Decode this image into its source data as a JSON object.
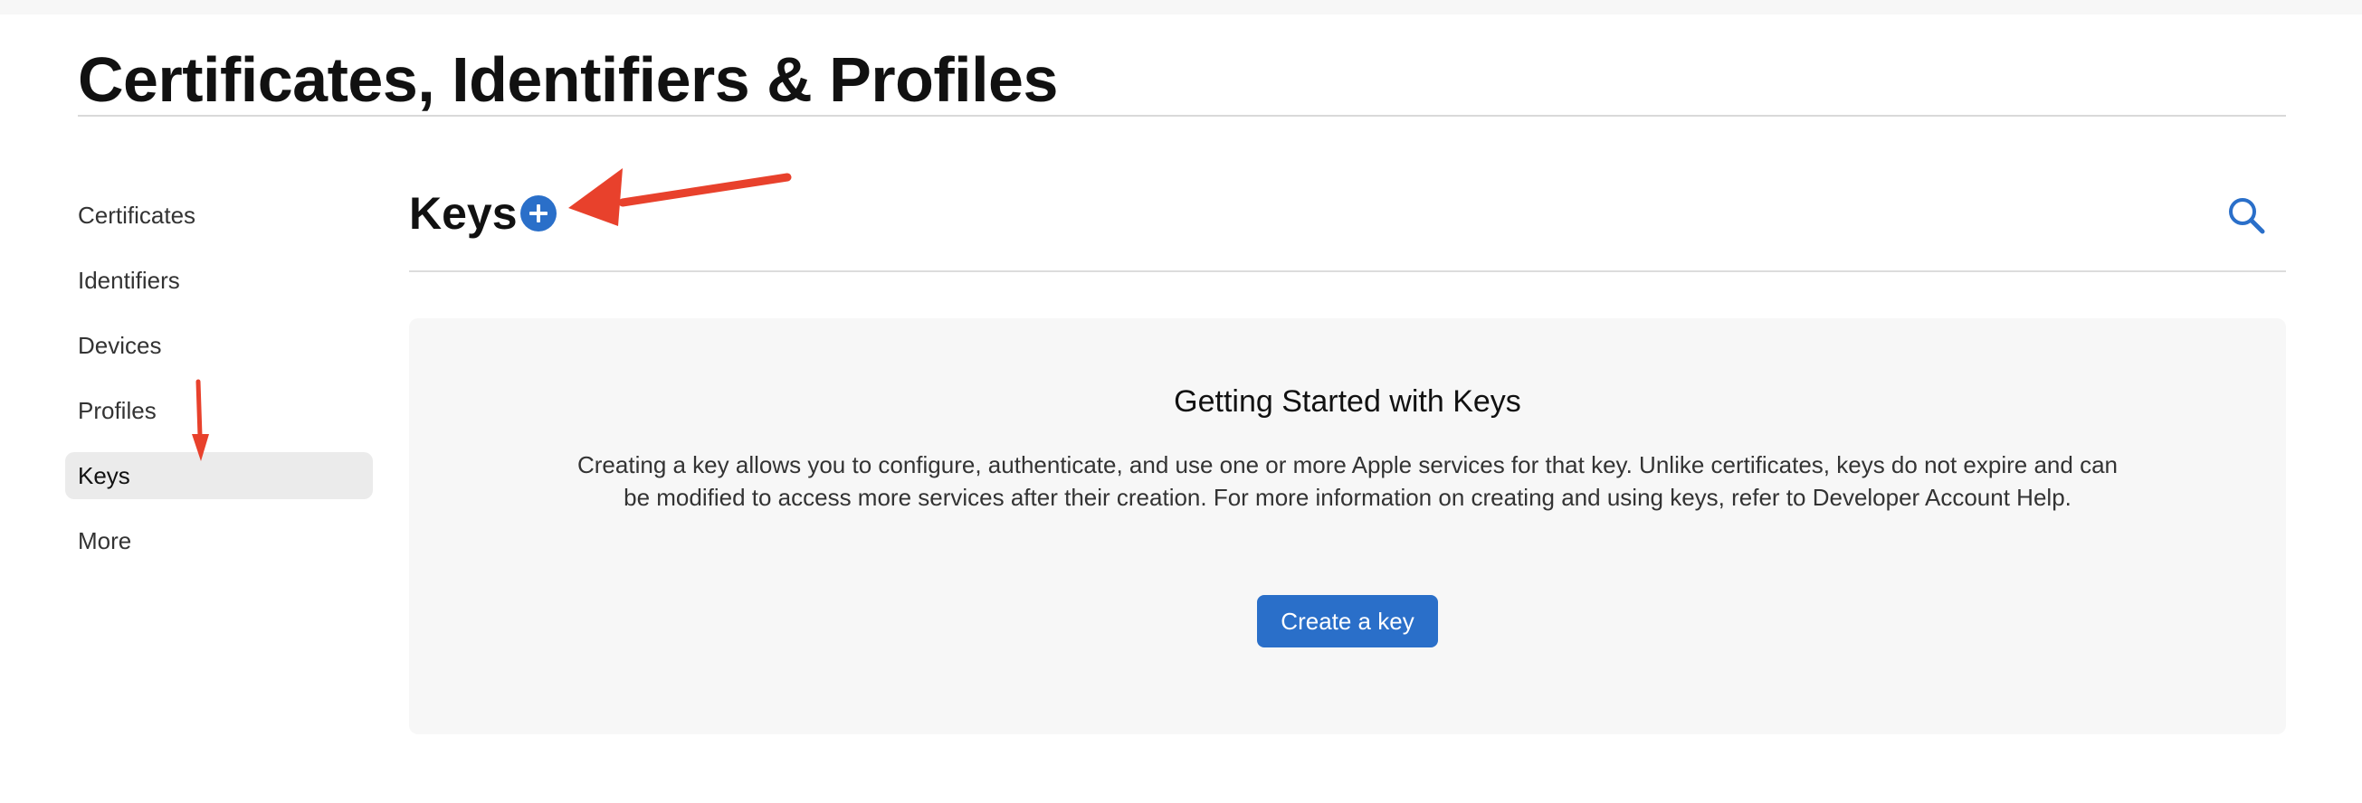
{
  "page": {
    "title": "Certificates, Identifiers & Profiles"
  },
  "sidebar": {
    "items": [
      {
        "label": "Certificates",
        "active": false
      },
      {
        "label": "Identifiers",
        "active": false
      },
      {
        "label": "Devices",
        "active": false
      },
      {
        "label": "Profiles",
        "active": false
      },
      {
        "label": "Keys",
        "active": true
      },
      {
        "label": "More",
        "active": false
      }
    ]
  },
  "section": {
    "title": "Keys",
    "add_icon": "plus-circle-icon",
    "search_icon": "search-icon"
  },
  "empty_state": {
    "heading": "Getting Started with Keys",
    "body": "Creating a key allows you to configure, authenticate, and use one or more Apple services for that key. Unlike certificates, keys do not expire and can be modified to access more services after their creation. For more information on creating and using keys, refer to Developer Account Help.",
    "button_label": "Create a key"
  },
  "annotations": {
    "arrow_color": "#e8412c"
  },
  "colors": {
    "accent": "#2a6fc9",
    "active_item_bg": "#ebebeb",
    "panel_bg": "#f7f7f7"
  }
}
